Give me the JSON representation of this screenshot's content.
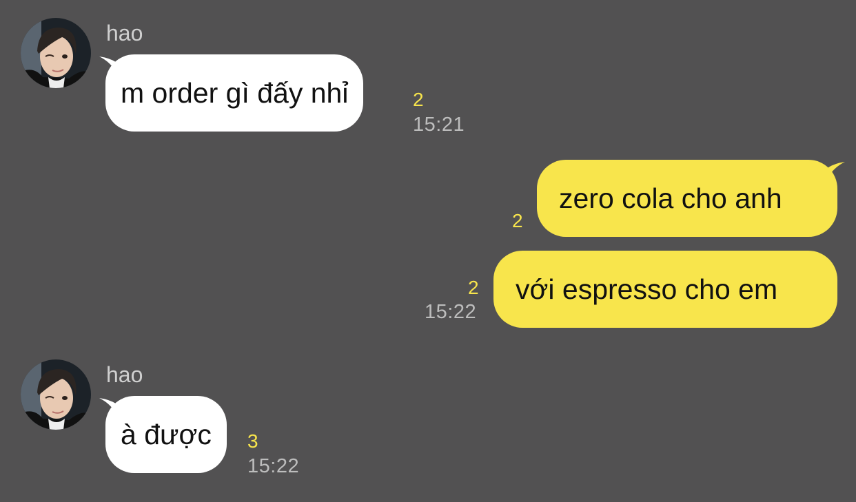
{
  "messages": [
    {
      "sender": "hao",
      "text": "m order gì đấy nhỉ",
      "unread": "2",
      "time": "15:21"
    },
    {
      "text": "zero cola cho anh",
      "unread": "2"
    },
    {
      "text": "với espresso cho em",
      "unread": "2",
      "time": "15:22"
    },
    {
      "sender": "hao",
      "text": "à được",
      "unread": "3",
      "time": "15:22"
    }
  ],
  "colors": {
    "background": "#525152",
    "incoming_bubble": "#ffffff",
    "outgoing_bubble": "#f8e54c",
    "unread_count": "#f8e54c",
    "timestamp": "#bdbdbd",
    "sender_name": "#cfcfcf"
  }
}
